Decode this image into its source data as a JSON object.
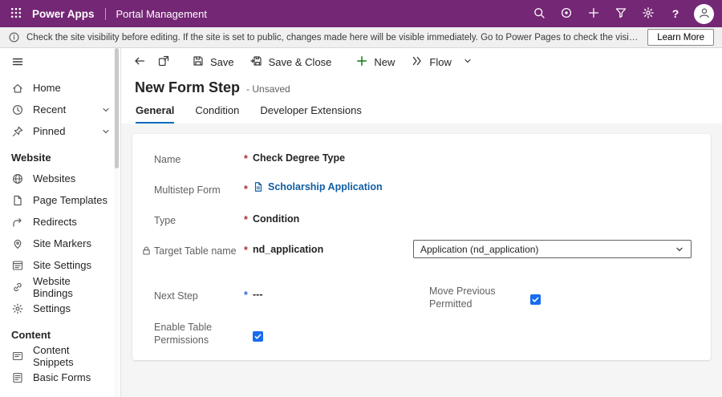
{
  "colors": {
    "header_purple": "#742774",
    "link_blue": "#115ea3",
    "required_red": "#ad2f33",
    "required_blue": "#2b6bd8",
    "checkbox_blue": "#1a6bef",
    "tab_underline_blue": "#0f6cbd"
  },
  "icons": {
    "help": "?"
  },
  "header": {
    "app_name": "Power Apps",
    "breadcrumb": "Portal Management"
  },
  "notification": {
    "message": "Check the site visibility before editing. If the site is set to public, changes made here will be visible immediately. Go to Power Pages to check the visibility of this site.",
    "action_label": "Learn More"
  },
  "sidebar": {
    "nav": [
      {
        "label": "Home"
      },
      {
        "label": "Recent"
      },
      {
        "label": "Pinned"
      }
    ],
    "sections": [
      {
        "title": "Website",
        "items": [
          "Websites",
          "Page Templates",
          "Redirects",
          "Site Markers",
          "Site Settings",
          "Website Bindings",
          "Settings"
        ]
      },
      {
        "title": "Content",
        "items": [
          "Content Snippets",
          "Basic Forms"
        ]
      }
    ]
  },
  "commandbar": {
    "save": "Save",
    "save_and_close": "Save & Close",
    "new": "New",
    "flow": "Flow"
  },
  "page": {
    "title": "New Form Step",
    "status": "- Unsaved",
    "tabs": [
      "General",
      "Condition",
      "Developer Extensions"
    ],
    "active_tab": "General"
  },
  "form": {
    "required_marker": "*",
    "name": {
      "label": "Name",
      "value": "Check Degree Type"
    },
    "multistep_form": {
      "label": "Multistep Form",
      "value": "Scholarship Application"
    },
    "type": {
      "label": "Type",
      "value": "Condition"
    },
    "target_table": {
      "label": "Target Table name",
      "value": "nd_application",
      "dropdown_value": "Application (nd_application)"
    },
    "next_step": {
      "label": "Next Step",
      "value": "---"
    },
    "move_previous_permitted": {
      "label": "Move Previous Permitted",
      "checked": true
    },
    "enable_table_permissions": {
      "label": "Enable Table Permissions",
      "checked": true
    }
  }
}
